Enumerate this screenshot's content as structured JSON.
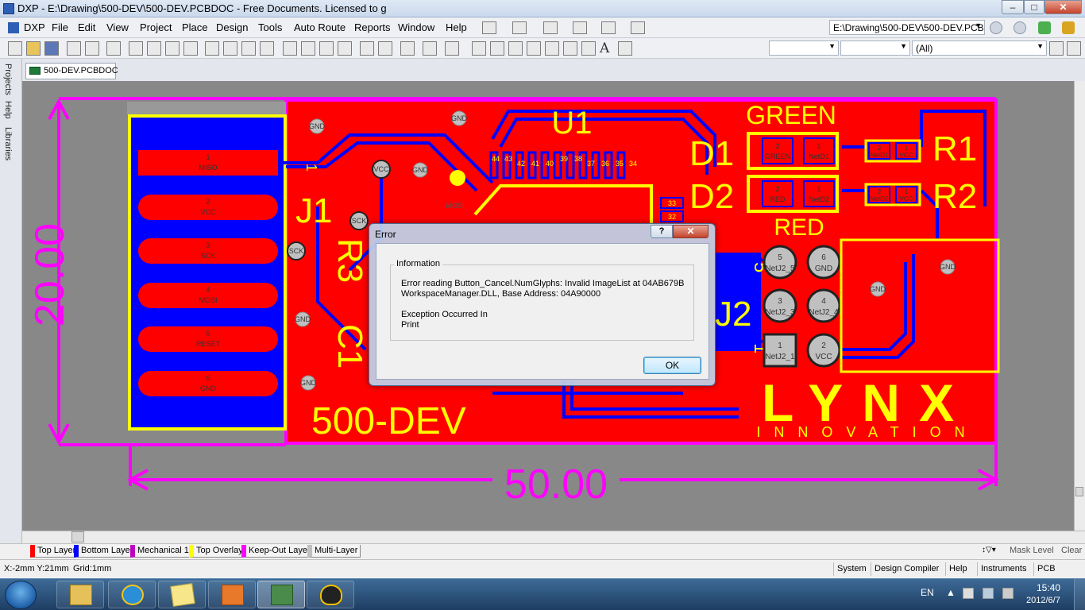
{
  "window": {
    "title": "DXP - E:\\Drawing\\500-DEV\\500-DEV.PCBDOC - Free Documents. Licensed to g",
    "btn_minimize": "–",
    "btn_maximize": "□",
    "btn_close": "✕"
  },
  "menu": {
    "items": [
      "DXP",
      "File",
      "Edit",
      "View",
      "Project",
      "Place",
      "Design",
      "Tools",
      "Auto Route",
      "Reports",
      "Window",
      "Help"
    ],
    "path_combo": "E:\\Drawing\\500-DEV\\500-DEV.PCBI"
  },
  "toolbar": {
    "filter_combo": "(All)"
  },
  "side_panel": {
    "tabs": [
      "Projects",
      "Help",
      "Libraries"
    ]
  },
  "document_tab": {
    "label": "500-DEV.PCBDOC"
  },
  "pcb": {
    "connector_pins": [
      {
        "num": "1",
        "name": "MISO"
      },
      {
        "num": "2",
        "name": "VCC"
      },
      {
        "num": "3",
        "name": "SCK"
      },
      {
        "num": "4",
        "name": "MOSI"
      },
      {
        "num": "5",
        "name": "RESET"
      },
      {
        "num": "6",
        "name": "GND"
      }
    ],
    "designators": {
      "j1": "J1",
      "r3": "R3",
      "c1": "C1",
      "u1": "U1",
      "d1": "D1",
      "d2": "D2",
      "r1": "R1",
      "r2": "R2",
      "j2": "J2"
    },
    "labels": {
      "green": "GREEN",
      "red": "RED",
      "board_name": "500-DEV",
      "logo": "LYNX",
      "logo_sub": "INNOVATION"
    },
    "dimensions": {
      "height": "20.00",
      "width": "50.00"
    },
    "net_labels": {
      "gnd": "GND",
      "vcc": "VCC",
      "sck": "SCK",
      "mosi": "MOSI",
      "netd1": "NetD1",
      "netd2": "NetD2",
      "netj2_5": "NetJ2_5",
      "netj2_3": "NetJ2_3",
      "netj2_4": "NetJ2_4",
      "netj2_1": "NetJ2_1"
    },
    "u1_pins": [
      "44",
      "43",
      "42",
      "41",
      "40",
      "39",
      "38",
      "37",
      "36",
      "35",
      "34"
    ],
    "u1_side_pins": [
      "33",
      "32"
    ],
    "j2_pads": [
      {
        "num": "5",
        "net": "NetJ2_5"
      },
      {
        "num": "6",
        "net": "GND"
      },
      {
        "num": "3",
        "net": "NetJ2_3"
      },
      {
        "num": "4",
        "net": "NetJ2_4"
      },
      {
        "num": "1",
        "net": "NetJ2_1"
      },
      {
        "num": "2",
        "net": "VCC"
      }
    ],
    "j2_side_nums": [
      "5",
      "1"
    ],
    "j1_side_num": "1",
    "led_pads": {
      "d1_a": "2",
      "d1_a_net": "GREEN",
      "d1_k": "1",
      "d1_k_net": "NetD1",
      "d2_a": "2",
      "d2_a_net": "RED",
      "d2_k": "1",
      "d2_k_net": "NetD2"
    },
    "res_pads": {
      "r1_a": "2",
      "r1_a_net": "NetD1",
      "r1_b": "1",
      "r1_b_net": "VCC",
      "r2_a": "2",
      "r2_a_net": "NetD2",
      "r2_b": "1",
      "r2_b_net": "VCC"
    }
  },
  "layers": {
    "tabs": [
      "Top Layer",
      "Bottom Layer",
      "Mechanical 1",
      "Top Overlay",
      "Keep-Out Layer",
      "Multi-Layer"
    ],
    "mask_level": "Mask Level",
    "clear": "Clear"
  },
  "status": {
    "coords": "X:-2mm Y:21mm",
    "grid": "Grid:1mm",
    "buttons": [
      "System",
      "Design Compiler",
      "Help",
      "Instruments",
      "PCB"
    ]
  },
  "taskbar": {
    "lang": "EN",
    "time": "15:40",
    "date": "2012/6/7"
  },
  "dialog": {
    "title": "Error",
    "help_btn": "?",
    "close_btn": "✕",
    "group_label": "Information",
    "line1": "Error reading Button_Cancel.NumGlyphs: Invalid ImageList at 04AB679B",
    "line2": "WorkspaceManager.DLL, Base Address: 04A90000",
    "line3": "Exception Occurred In",
    "line4": "Print",
    "ok_label": "OK"
  },
  "colors": {
    "board_top": "#ff0000",
    "board_bottom": "#0000ff",
    "overlay": "#ffff00",
    "keepout": "#ff00ff",
    "pad": "#c0c0c0",
    "canvas": "#888888"
  }
}
